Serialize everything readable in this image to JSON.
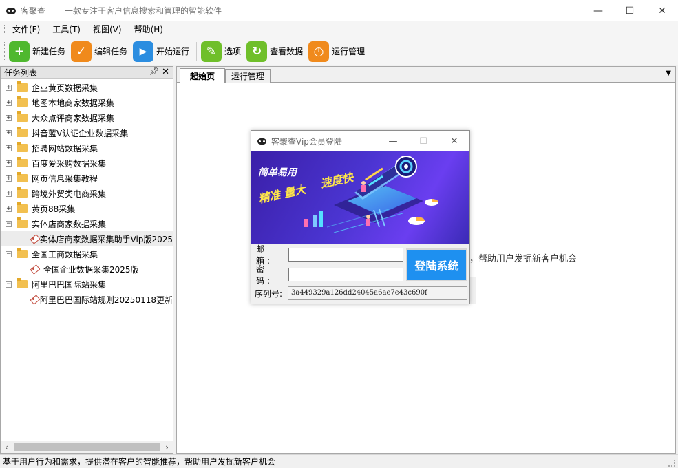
{
  "window": {
    "app_name": "客聚查",
    "slogan": "一款专注于客户信息搜索和管理的智能软件",
    "controls": {
      "minimize": "—",
      "maximize": "☐",
      "close": "✕"
    }
  },
  "menu": [
    "文件(F)",
    "工具(T)",
    "视图(V)",
    "帮助(H)"
  ],
  "toolbar": [
    {
      "label": "新建任务",
      "icon": "plus-icon",
      "glyph": "+",
      "color": "#4fb82f"
    },
    {
      "label": "编辑任务",
      "icon": "check-icon",
      "glyph": "✓",
      "color": "#f08a1c"
    },
    {
      "label": "开始运行",
      "icon": "play-icon",
      "glyph": "▶",
      "color": "#2b8de0"
    },
    {
      "label": "选项",
      "icon": "wrench-icon",
      "glyph": "✎",
      "color": "#6fbf2a"
    },
    {
      "label": "查看数据",
      "icon": "refresh-icon",
      "glyph": "↻",
      "color": "#6fbf2a"
    },
    {
      "label": "运行管理",
      "icon": "clock-icon",
      "glyph": "◷",
      "color": "#f08a1c"
    }
  ],
  "left_panel": {
    "title": "任务列表",
    "pin": "ᵖ",
    "close": "✕",
    "tree": [
      {
        "label": "企业黄页数据采集",
        "type": "folder",
        "expander": "+"
      },
      {
        "label": "地图本地商家数据采集",
        "type": "folder",
        "expander": "+"
      },
      {
        "label": "大众点评商家数据采集",
        "type": "folder",
        "expander": "+"
      },
      {
        "label": "抖音蓝V认证企业数据采集",
        "type": "folder",
        "expander": "+"
      },
      {
        "label": "招聘网站数据采集",
        "type": "folder",
        "expander": "+"
      },
      {
        "label": "百度爱采购数据采集",
        "type": "folder",
        "expander": "+"
      },
      {
        "label": "网页信息采集教程",
        "type": "folder",
        "expander": "+"
      },
      {
        "label": "跨境外贸类电商采集",
        "type": "folder",
        "expander": "+"
      },
      {
        "label": "黄页88采集",
        "type": "folder",
        "expander": "+"
      },
      {
        "label": "实体店商家数据采集",
        "type": "folder",
        "expander": "−"
      },
      {
        "label": "实体店商家数据采集助手Vip版2025",
        "type": "task",
        "selected": true
      },
      {
        "label": "全国工商数据采集",
        "type": "folder",
        "expander": "−"
      },
      {
        "label": "全国企业数据采集2025版",
        "type": "task"
      },
      {
        "label": "阿里巴巴国际站采集",
        "type": "folder",
        "expander": "−"
      },
      {
        "label": "阿里巴巴国际站规则20250118更新",
        "type": "task"
      }
    ]
  },
  "tabs": [
    {
      "label": "起始页",
      "active": true
    },
    {
      "label": "运行管理",
      "active": false
    }
  ],
  "tab_dropdown": "▼",
  "behind_text": "，帮助用户发掘新客户机会",
  "dialog": {
    "title": "客聚查Vip会员登陆",
    "controls": {
      "minimize": "—",
      "maximize": "☐",
      "close": "✕"
    },
    "banner": {
      "slogan_top": "简单易用",
      "slogan_a": "精准 量大",
      "slogan_b": "速度快"
    },
    "email_label": "邮 箱:",
    "email_value": "",
    "password_label": "密 码:",
    "password_value": "",
    "login_button": "登陆系统",
    "serial_label": "序列号:",
    "serial_value": "3a449329a126dd24045a6ae7e43c690f"
  },
  "status": "基于用户行为和需求，提供潜在客户的智能推荐，帮助用户发掘新客户机会"
}
